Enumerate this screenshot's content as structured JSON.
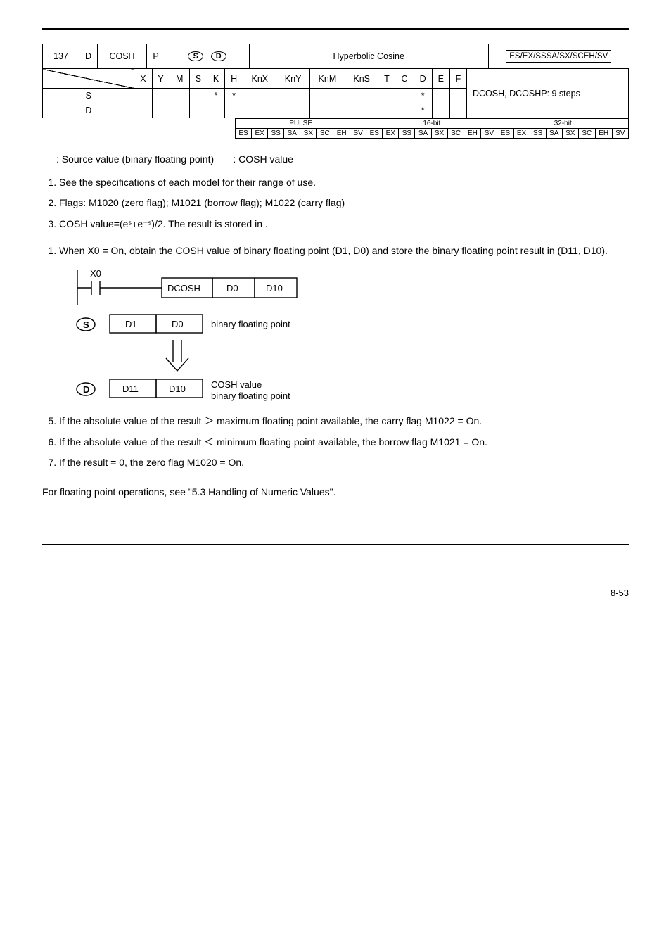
{
  "api": {
    "col1": "137",
    "col2": "D",
    "col3": "COSH",
    "col4": "P",
    "operands_label_s": "S",
    "operands_label_d": "D",
    "function": "Hyperbolic Cosine",
    "applicable_1": "ES/EX/SS",
    "applicable_2": "SA/SX/SC",
    "applicable_3": "EH/SV"
  },
  "grid": {
    "headers": [
      "X",
      "Y",
      "M",
      "S",
      "K",
      "H",
      "KnX",
      "KnY",
      "KnM",
      "KnS",
      "T",
      "C",
      "D",
      "E",
      "F"
    ],
    "rows": [
      {
        "label": "S",
        "cells": [
          "",
          "",
          "",
          "",
          "*",
          "*",
          "",
          "",
          "",
          "",
          "",
          "",
          "*",
          "",
          ""
        ]
      },
      {
        "label": "D",
        "cells": [
          "",
          "",
          "",
          "",
          "",
          "",
          "",
          "",
          "",
          "",
          "",
          "",
          "*",
          "",
          ""
        ]
      }
    ],
    "steps": "DCOSH, DCOSHP: 9 steps"
  },
  "pulse_table": {
    "headers": [
      "PULSE",
      "16-bit",
      "32-bit"
    ],
    "cells": [
      "ES",
      "EX",
      "SS",
      "SA",
      "SX",
      "SC",
      "EH",
      "SV",
      "ES",
      "EX",
      "SS",
      "SA",
      "SX",
      "SC",
      "EH",
      "SV",
      "ES",
      "EX",
      "SS",
      "SA",
      "SX",
      "SC",
      "EH",
      "SV"
    ]
  },
  "operands_text": {
    "s": ": Source value (binary floating point)",
    "d": ": COSH value"
  },
  "explanations": [
    "See the specifications of each model for their range of use.",
    "Flags: M1020 (zero flag); M1021 (borrow flag); M1022 (carry flag)",
    "COSH value=(eˢ+e⁻ˢ)/2. The result is stored in   ."
  ],
  "program_intro": "When X0 = On, obtain the COSH value of binary floating point (D1, D0) and store the binary floating point result in (D11, D10).",
  "diagram": {
    "x0": "X0",
    "dcosh": "DCOSH",
    "d0": "D0",
    "d10": "D10",
    "s_d1": "D1",
    "s_d0": "D0",
    "s_note": "binary floating point",
    "d_d11": "D11",
    "d_d10": "D10",
    "d_note1": "COSH value",
    "d_note2": "binary floating point"
  },
  "program_notes": {
    "n5": "If the absolute value of the result ＞ maximum floating point available, the carry flag M1022 = On.",
    "n6": "If the absolute value of the result ＜ minimum floating point available, the borrow flag M1021 = On.",
    "n7": "If the result = 0, the zero flag M1020 = On."
  },
  "remarks": "For floating point operations, see \"5.3 Handling of Numeric Values\".",
  "page": "8-53"
}
